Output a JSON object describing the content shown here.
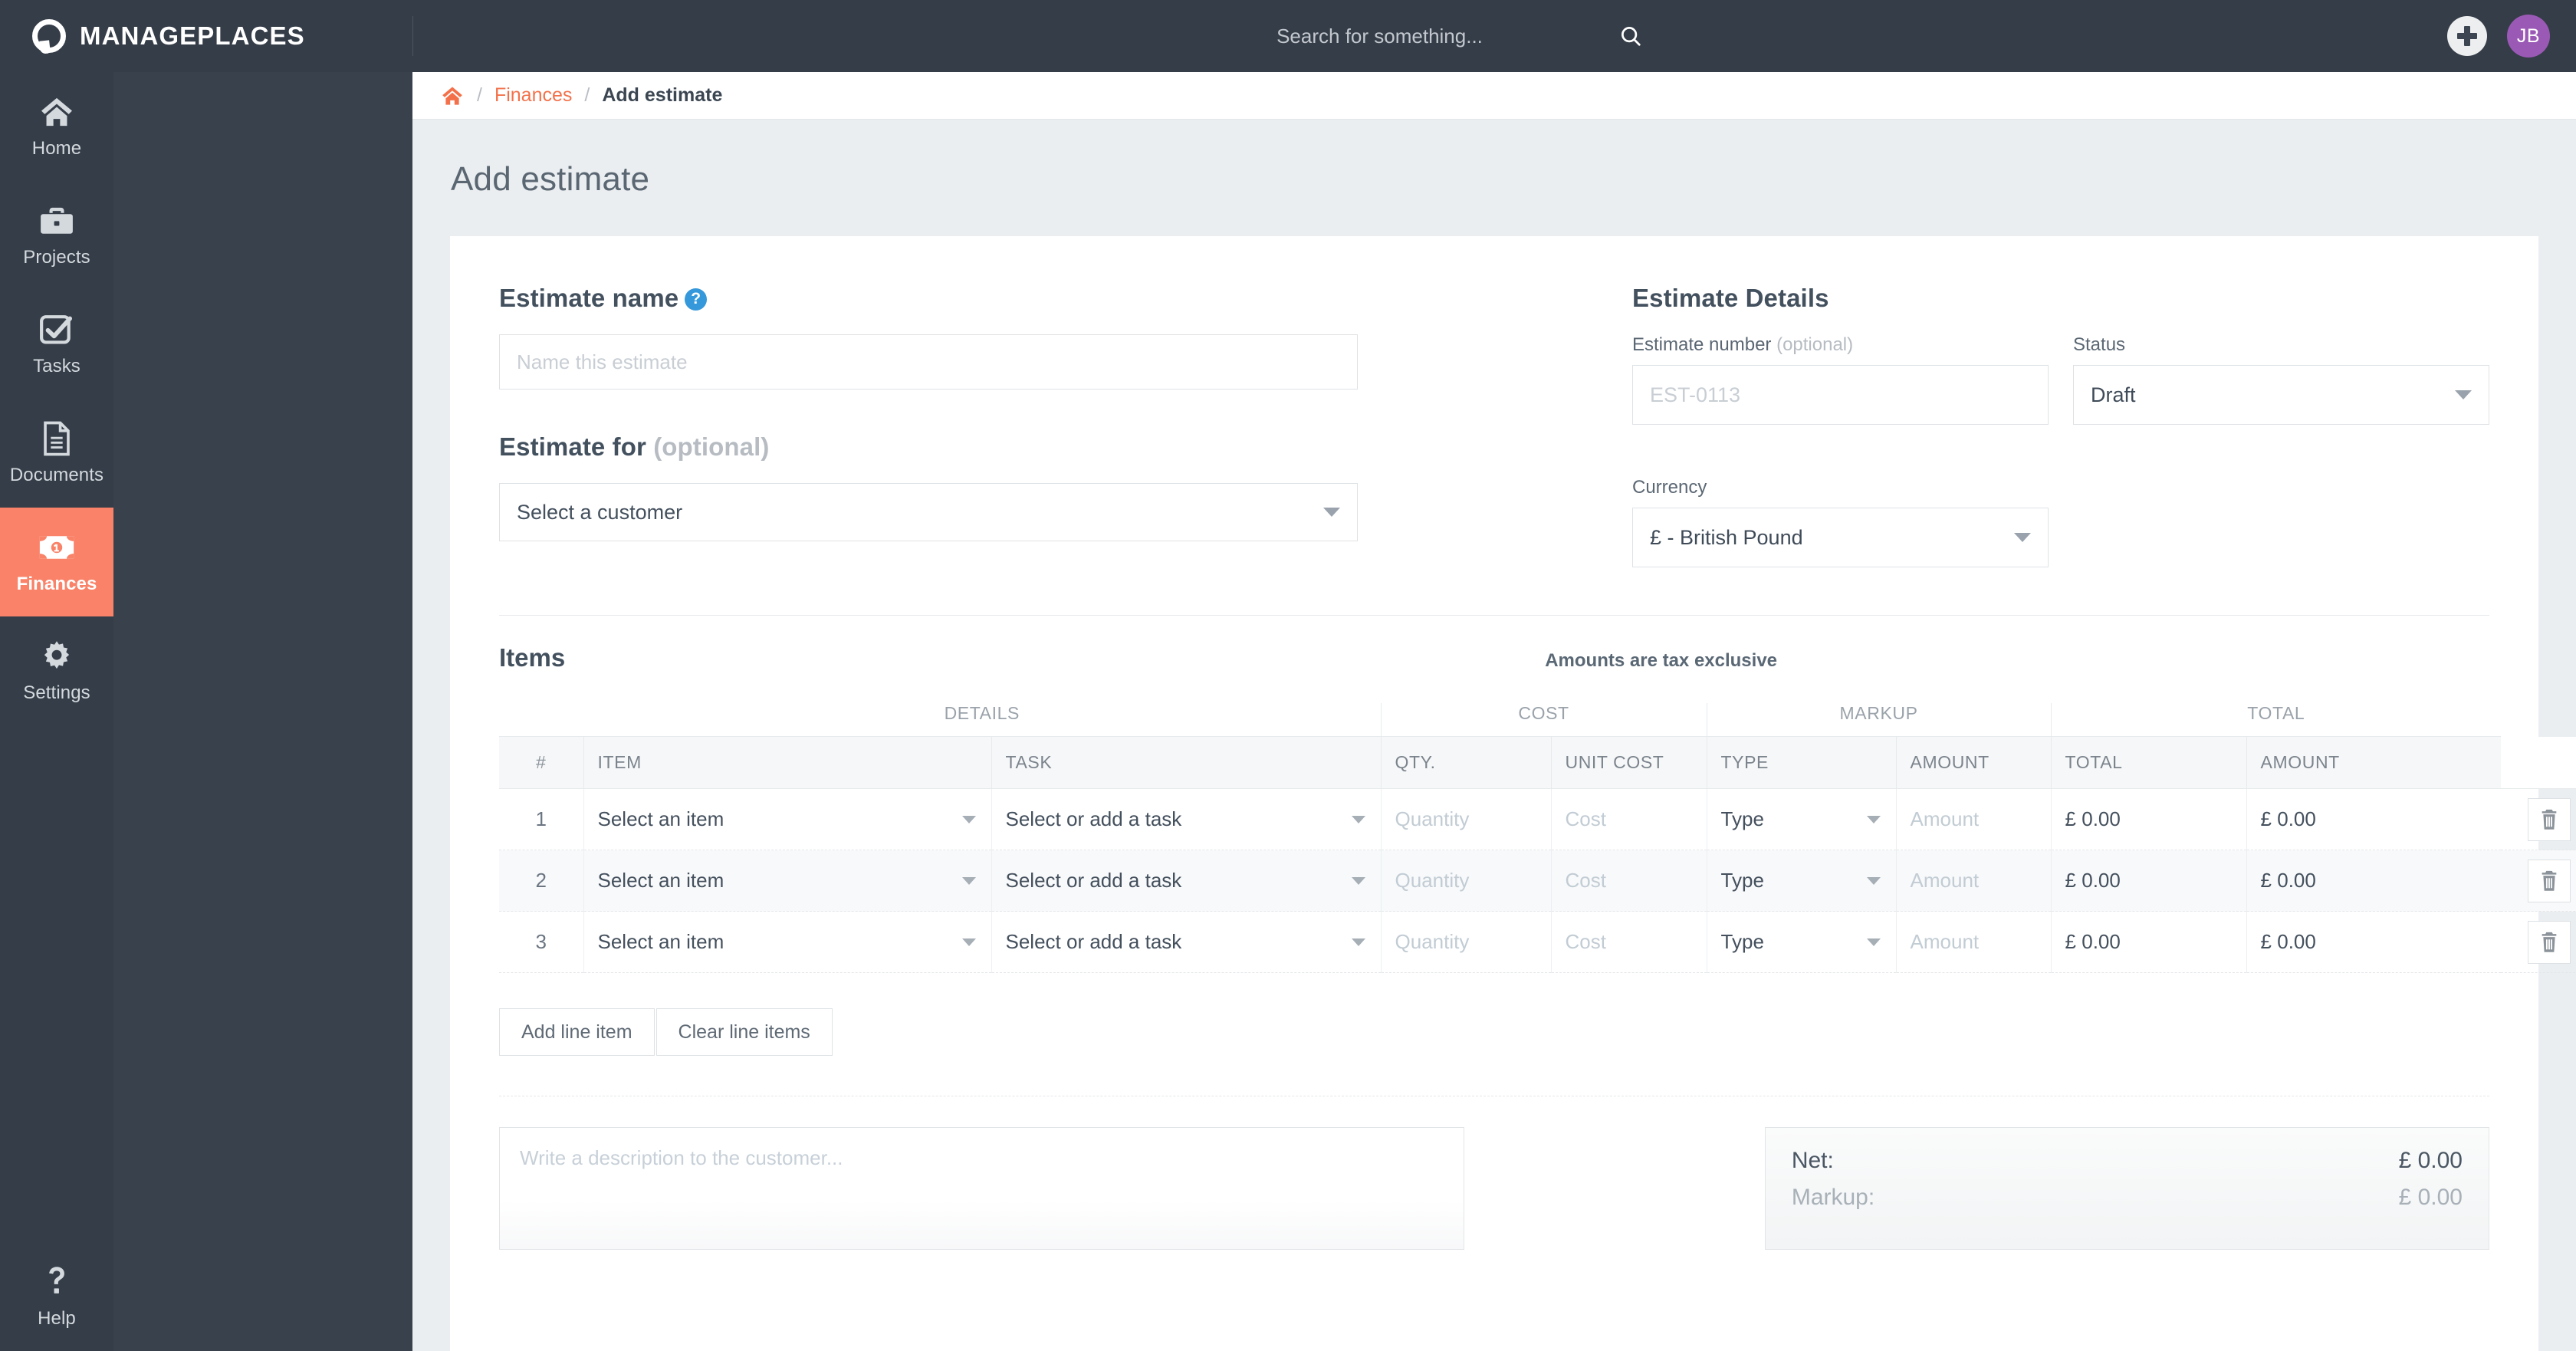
{
  "brand": {
    "name": "MANAGEPLACES"
  },
  "topbar": {
    "search_placeholder": "Search for something...",
    "search_value": "",
    "add_label": "+",
    "avatar_initials": "JB"
  },
  "sidebar": {
    "items": [
      {
        "label": "Home",
        "icon": "home-icon",
        "active": false
      },
      {
        "label": "Projects",
        "icon": "briefcase-icon",
        "active": false
      },
      {
        "label": "Tasks",
        "icon": "check-square-icon",
        "active": false
      },
      {
        "label": "Documents",
        "icon": "document-icon",
        "active": false
      },
      {
        "label": "Finances",
        "icon": "banknote-icon",
        "active": true
      },
      {
        "label": "Settings",
        "icon": "gear-icon",
        "active": false
      }
    ],
    "help": {
      "label": "Help",
      "icon": "question-mark-icon"
    },
    "active_color": "#f98268",
    "background_color": "#353d48"
  },
  "breadcrumb": {
    "home_icon": "home-icon",
    "separator": "/",
    "link": "Finances",
    "current": "Add estimate"
  },
  "page": {
    "title": "Add estimate"
  },
  "estimate_name": {
    "heading": "Estimate name",
    "help_icon": "question-circle-icon",
    "placeholder": "Name this estimate",
    "value": ""
  },
  "estimate_for": {
    "heading": "Estimate for",
    "optional": "(optional)",
    "selected": "Select a customer"
  },
  "estimate_details": {
    "heading": "Estimate Details",
    "number_label": "Estimate number",
    "number_optional": "(optional)",
    "number_placeholder": "EST-0113",
    "number_value": "",
    "status_label": "Status",
    "status_value": "Draft",
    "currency_label": "Currency",
    "currency_value": "£ - British Pound"
  },
  "items": {
    "title": "Items",
    "tax_note": "Amounts are tax exclusive",
    "group_headers": {
      "details": "DETAILS",
      "cost": "COST",
      "markup": "MARKUP",
      "total": "TOTAL"
    },
    "columns": {
      "num": "#",
      "item": "ITEM",
      "task": "TASK",
      "qty": "QTY.",
      "unit_cost": "UNIT COST",
      "type": "TYPE",
      "markup_amount": "AMOUNT",
      "markup_total": "TOTAL",
      "total_amount": "AMOUNT"
    },
    "placeholders": {
      "item": "Select an item",
      "task": "Select or add a task",
      "qty": "Quantity",
      "cost": "Cost",
      "type": "Type",
      "amount": "Amount"
    },
    "rows": [
      {
        "num": "1",
        "item": "Select an item",
        "task": "Select or add a task",
        "qty": "Quantity",
        "cost": "Cost",
        "type": "Type",
        "markup_amount": "Amount",
        "markup_total": "£ 0.00",
        "total_amount": "£ 0.00",
        "delete_icon": "trash-icon"
      },
      {
        "num": "2",
        "item": "Select an item",
        "task": "Select or add a task",
        "qty": "Quantity",
        "cost": "Cost",
        "type": "Type",
        "markup_amount": "Amount",
        "markup_total": "£ 0.00",
        "total_amount": "£ 0.00",
        "delete_icon": "trash-icon"
      },
      {
        "num": "3",
        "item": "Select an item",
        "task": "Select or add a task",
        "qty": "Quantity",
        "cost": "Cost",
        "type": "Type",
        "markup_amount": "Amount",
        "markup_total": "£ 0.00",
        "total_amount": "£ 0.00",
        "delete_icon": "trash-icon"
      }
    ],
    "add_button": "Add line item",
    "clear_button": "Clear line items"
  },
  "description": {
    "placeholder": "Write a description to the customer...",
    "value": ""
  },
  "totals": {
    "net_label": "Net:",
    "net_value": "£ 0.00",
    "markup_label": "Markup:",
    "markup_value": "£ 0.00"
  }
}
